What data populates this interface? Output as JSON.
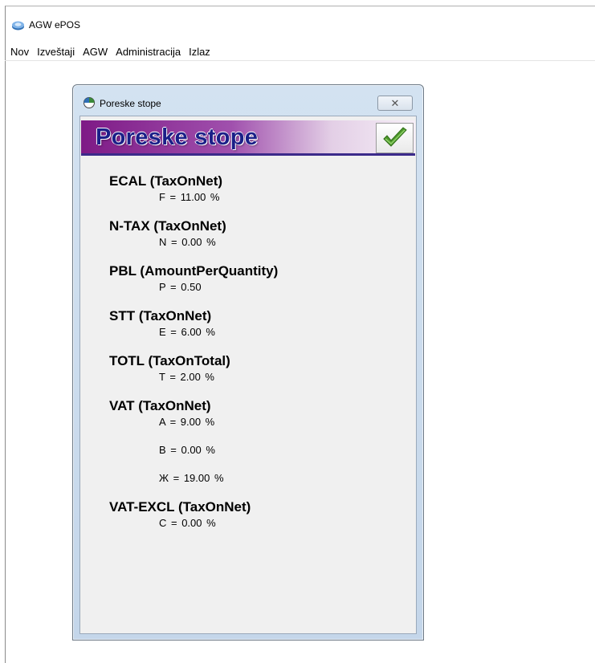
{
  "app": {
    "title": "AGW ePOS",
    "icon": "app-disc-icon"
  },
  "menu": [
    {
      "label": "Nov"
    },
    {
      "label": "Izveštaji"
    },
    {
      "label": "AGW"
    },
    {
      "label": "Administracija"
    },
    {
      "label": "Izlaz"
    }
  ],
  "dialog": {
    "title": "Poreske stope",
    "header": "Poreske stope",
    "close_glyph": "✕",
    "confirm_icon": "checkmark-icon",
    "colors": {
      "header_accent": "#7e1a86",
      "header_text": "#1b1f88",
      "check": "#4f9a2c"
    },
    "taxes": [
      {
        "name": "ECAL (TaxOnNet)",
        "rates": [
          "F =  11.00 %"
        ]
      },
      {
        "name": "N-TAX (TaxOnNet)",
        "rates": [
          "N =  0.00 %"
        ]
      },
      {
        "name": "PBL (AmountPerQuantity)",
        "rates": [
          "P =  0.50"
        ]
      },
      {
        "name": "STT (TaxOnNet)",
        "rates": [
          "E =  6.00 %"
        ]
      },
      {
        "name": "TOTL (TaxOnTotal)",
        "rates": [
          "T =  2.00 %"
        ]
      },
      {
        "name": "VAT (TaxOnNet)",
        "rates": [
          "A =  9.00 %",
          "B =  0.00 %",
          "Ж =  19.00 %"
        ]
      },
      {
        "name": "VAT-EXCL (TaxOnNet)",
        "rates": [
          "C =  0.00 %"
        ]
      }
    ]
  }
}
